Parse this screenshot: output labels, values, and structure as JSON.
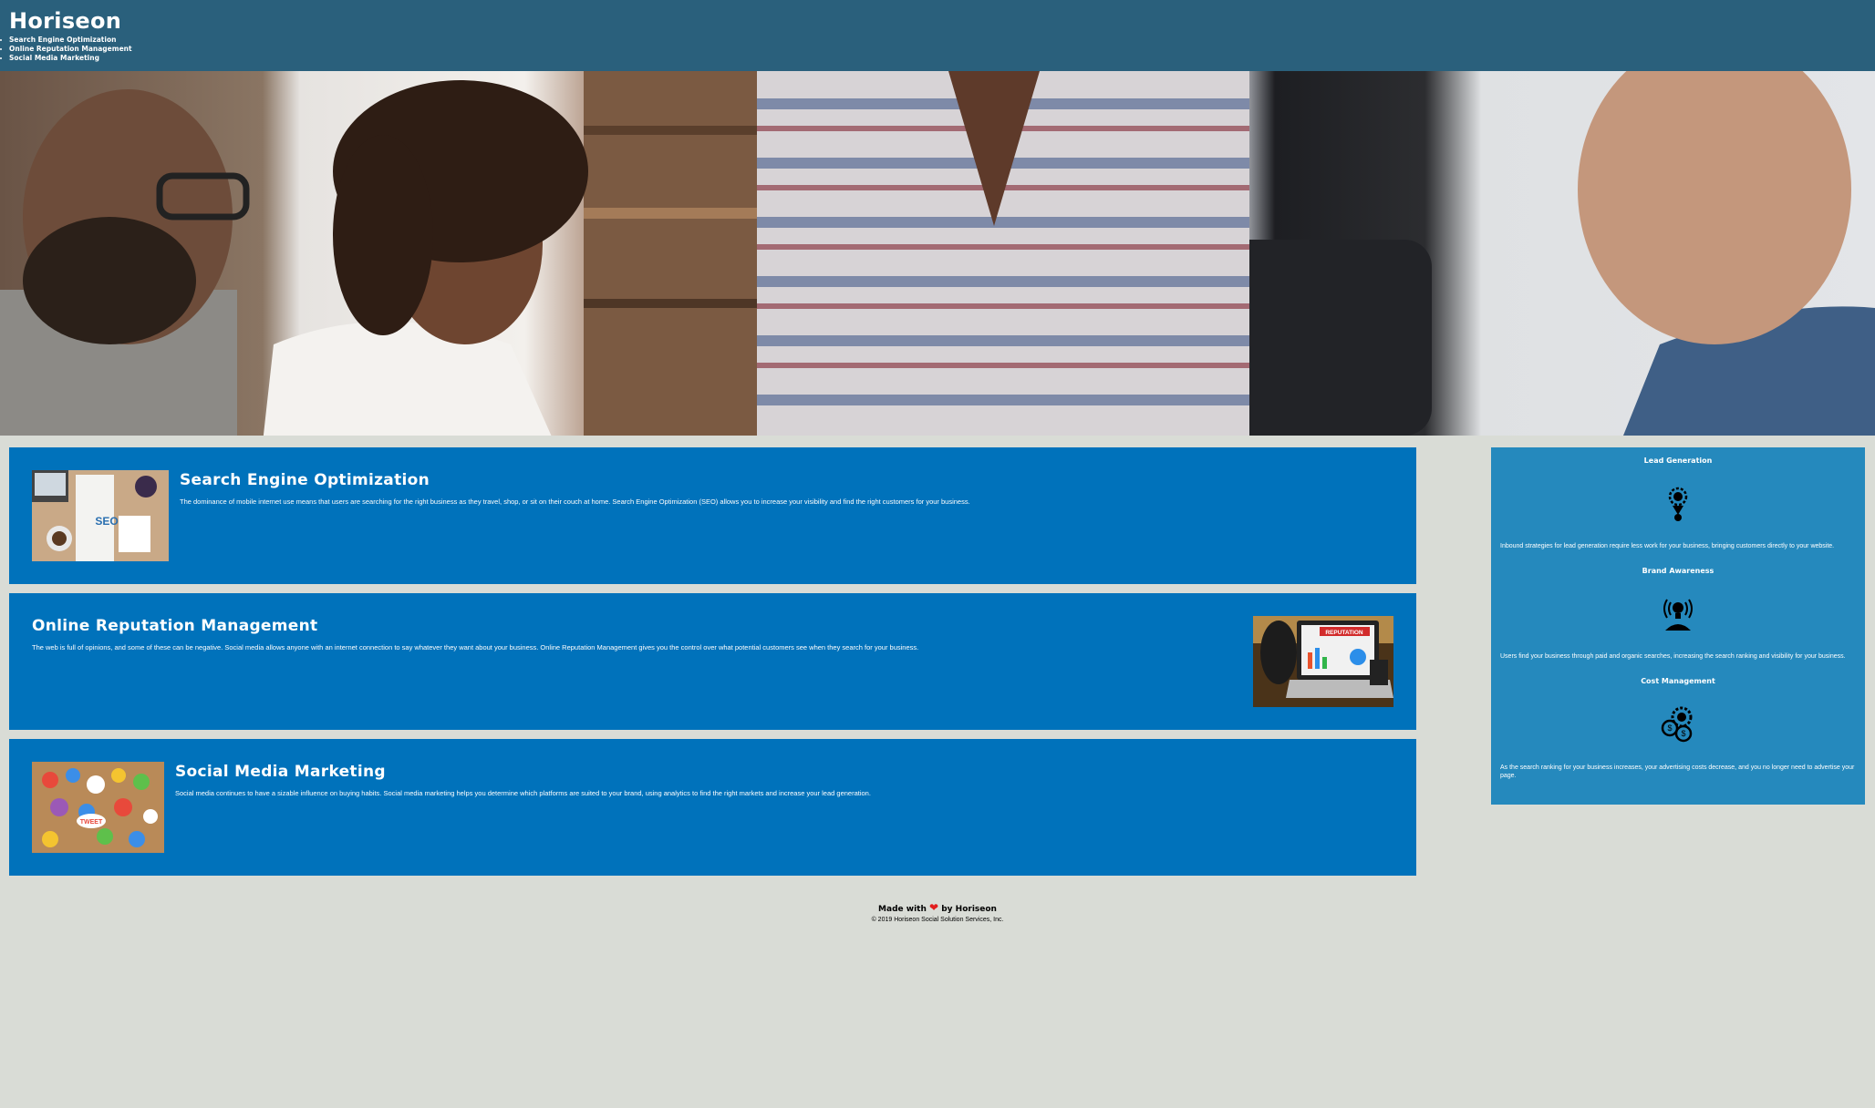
{
  "header": {
    "logo": "Horiseon",
    "nav": [
      "Search Engine Optimization",
      "Online Reputation Management",
      "Social Media Marketing"
    ]
  },
  "services": [
    {
      "title": "Search Engine Optimization",
      "text": "The dominance of mobile internet use means that users are searching for the right business as they travel, shop, or sit on their couch at home. Search Engine Optimization (SEO) allows you to increase your visibility and find the right customers for your business.",
      "image_label": "SEO"
    },
    {
      "title": "Online Reputation Management",
      "text": "The web is full of opinions, and some of these can be negative. Social media allows anyone with an internet connection to say whatever they want about your business. Online Reputation Management gives you the control over what potential customers see when they search for your business.",
      "image_label": "REPUTATION"
    },
    {
      "title": "Social Media Marketing",
      "text": "Social media continues to have a sizable influence on buying habits. Social media marketing helps you determine which platforms are suited to your brand, using analytics to find the right markets and increase your lead generation.",
      "image_label": "TWEET"
    }
  ],
  "benefits": [
    {
      "title": "Lead Generation",
      "icon": "lightbulb-gear-icon",
      "text": "Inbound strategies for lead generation require less work for your business, bringing customers directly to your website."
    },
    {
      "title": "Brand Awareness",
      "icon": "lightbulb-signal-icon",
      "text": "Users find your business through paid and organic searches, increasing the search ranking and visibility for your business."
    },
    {
      "title": "Cost Management",
      "icon": "coins-gear-icon",
      "text": "As the search ranking for your business increases, your advertising costs decrease, and you no longer need to advertise your page."
    }
  ],
  "footer": {
    "made_prefix": "Made with",
    "made_suffix": "by Horiseon",
    "copyright": "© 2019 Horiseon Social Solution Services, Inc."
  },
  "colors": {
    "header_bg": "#2a607c",
    "card_bg": "#0072bb",
    "sidebar_bg": "#2589bd",
    "page_bg": "#d9dcd6",
    "heart": "#e21d1d"
  }
}
